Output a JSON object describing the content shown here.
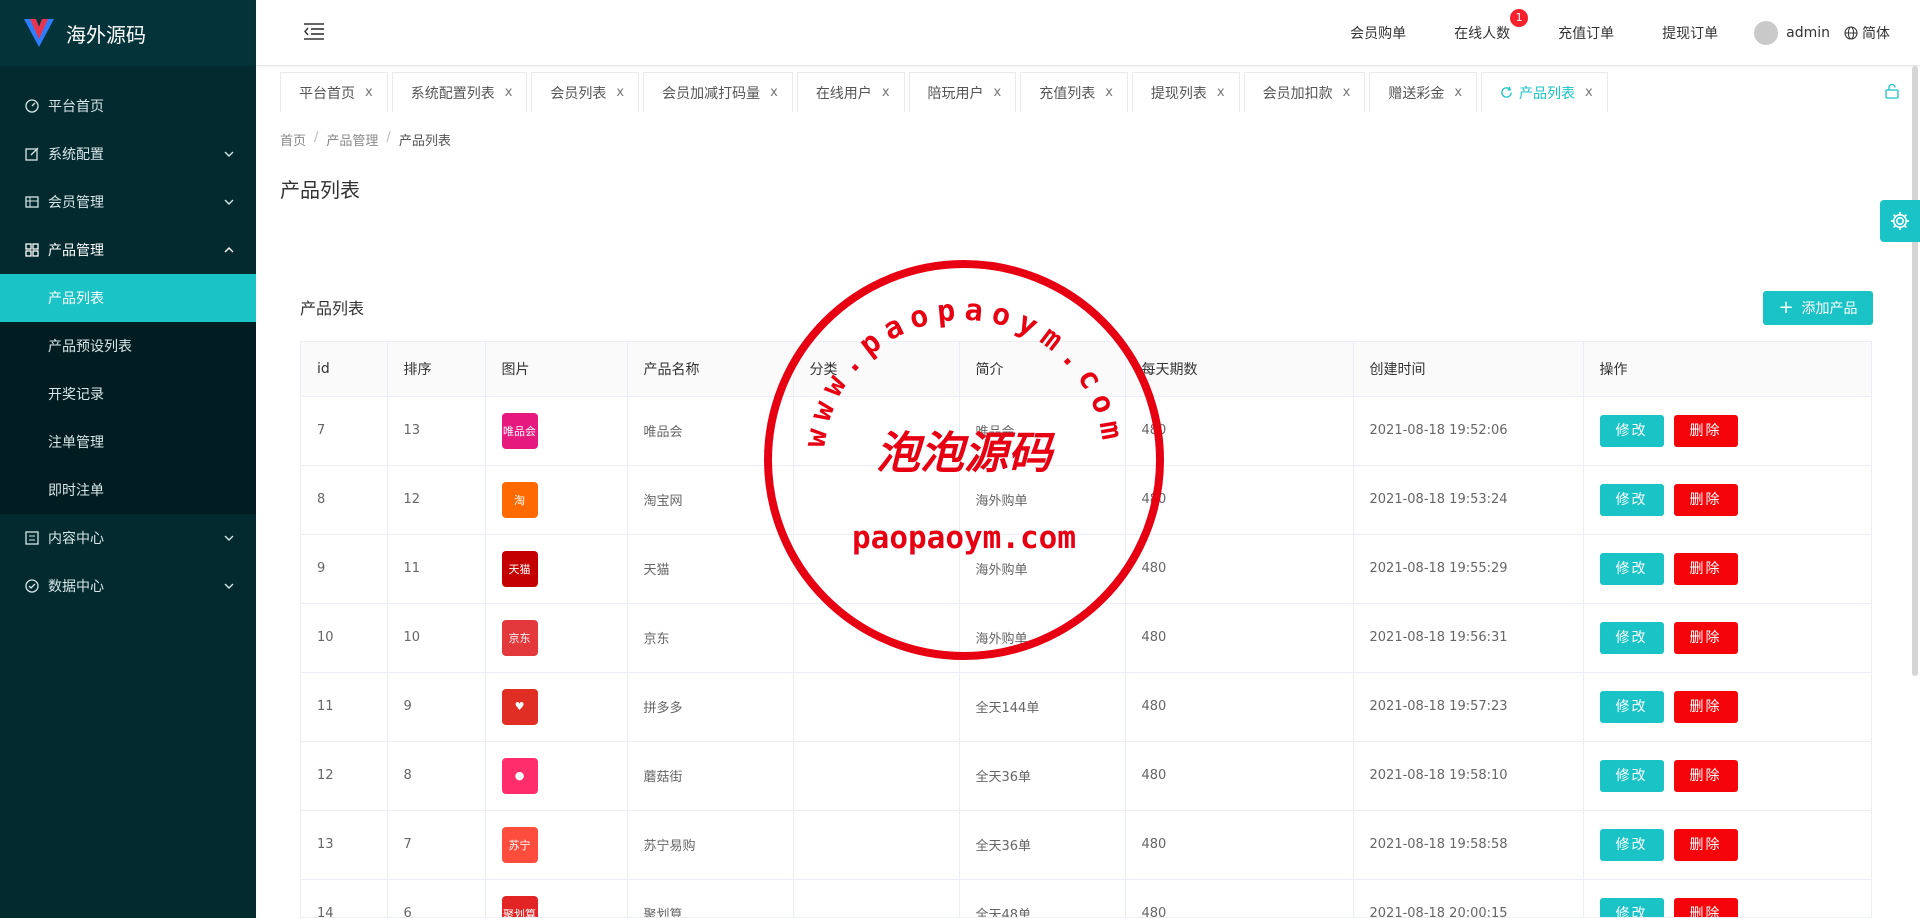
{
  "app": {
    "title": "海外源码"
  },
  "sidebar": {
    "items": [
      {
        "label": "平台首页",
        "icon": "dashboard-icon",
        "expandable": false
      },
      {
        "label": "系统配置",
        "icon": "edit-icon",
        "expandable": true
      },
      {
        "label": "会员管理",
        "icon": "table-icon",
        "expandable": true
      },
      {
        "label": "产品管理",
        "icon": "grid-icon",
        "expandable": true,
        "open": true
      }
    ],
    "sub_items": [
      {
        "label": "产品列表",
        "active": true
      },
      {
        "label": "产品预设列表"
      },
      {
        "label": "开奖记录"
      },
      {
        "label": "注单管理"
      },
      {
        "label": "即时注单"
      }
    ],
    "items_after": [
      {
        "label": "内容中心",
        "icon": "document-icon"
      },
      {
        "label": "数据中心",
        "icon": "check-circle-icon"
      }
    ]
  },
  "header": {
    "links": [
      "会员购单",
      "在线人数",
      "充值订单",
      "提现订单"
    ],
    "online_badge": "1",
    "user": "admin",
    "lang": "简体"
  },
  "tabs": [
    {
      "label": "平台首页"
    },
    {
      "label": "系统配置列表"
    },
    {
      "label": "会员列表"
    },
    {
      "label": "会员加减打码量"
    },
    {
      "label": "在线用户"
    },
    {
      "label": "陪玩用户"
    },
    {
      "label": "充值列表"
    },
    {
      "label": "提现列表"
    },
    {
      "label": "会员加扣款"
    },
    {
      "label": "赠送彩金"
    },
    {
      "label": "产品列表",
      "active": true
    }
  ],
  "tab_close_glyph": "x",
  "breadcrumb": {
    "home": "首页",
    "section": "产品管理",
    "current": "产品列表",
    "sep": "/"
  },
  "page_title": "产品列表",
  "card": {
    "title": "产品列表",
    "add_label": "添加产品",
    "add_plus": "+"
  },
  "table": {
    "headers": [
      "id",
      "排序",
      "图片",
      "产品名称",
      "分类",
      "简介",
      "每天期数",
      "创建时间",
      "操作"
    ],
    "edit_label": "修改",
    "delete_label": "删除",
    "rows": [
      {
        "id": "7",
        "sort": "13",
        "img": "唯品会",
        "img_color": "#e6197e",
        "name": "唯品会",
        "category": "",
        "intro": "唯品会",
        "periods": "480",
        "created": "2021-08-18 19:52:06"
      },
      {
        "id": "8",
        "sort": "12",
        "img": "淘",
        "img_color": "#ff6a00",
        "name": "淘宝网",
        "category": "",
        "intro": "海外购单",
        "periods": "480",
        "created": "2021-08-18 19:53:24"
      },
      {
        "id": "9",
        "sort": "11",
        "img": "天猫",
        "img_color": "#c40000",
        "name": "天猫",
        "category": "",
        "intro": "海外购单",
        "periods": "480",
        "created": "2021-08-18 19:55:29"
      },
      {
        "id": "10",
        "sort": "10",
        "img": "京东",
        "img_color": "#e4393c",
        "name": "京东",
        "category": "",
        "intro": "海外购单",
        "periods": "480",
        "created": "2021-08-18 19:56:31"
      },
      {
        "id": "11",
        "sort": "9",
        "img": "♥",
        "img_color": "#e02e24",
        "name": "拼多多",
        "category": "",
        "intro": "全天144单",
        "periods": "480",
        "created": "2021-08-18 19:57:23"
      },
      {
        "id": "12",
        "sort": "8",
        "img": "●",
        "img_color": "#ff2d6b",
        "name": "蘑菇街",
        "category": "",
        "intro": "全天36单",
        "periods": "480",
        "created": "2021-08-18 19:58:10"
      },
      {
        "id": "13",
        "sort": "7",
        "img": "苏宁",
        "img_color": "#ff4d3d",
        "name": "苏宁易购",
        "category": "",
        "intro": "全天36单",
        "periods": "480",
        "created": "2021-08-18 19:58:58"
      },
      {
        "id": "14",
        "sort": "6",
        "img": "聚划算",
        "img_color": "#e22424",
        "name": "聚划算",
        "category": "",
        "intro": "全天48单",
        "periods": "480",
        "created": "2021-08-18 20:00:15"
      }
    ]
  },
  "stamp": {
    "ring_text": "www.paopaoym.com",
    "center_text": "泡泡源码",
    "bottom_text": "paopaoym.com",
    "color": "#e60012"
  },
  "colors": {
    "accent": "#19c3c6",
    "danger": "#f5050a",
    "sidebar_bg": "#032a2f"
  }
}
